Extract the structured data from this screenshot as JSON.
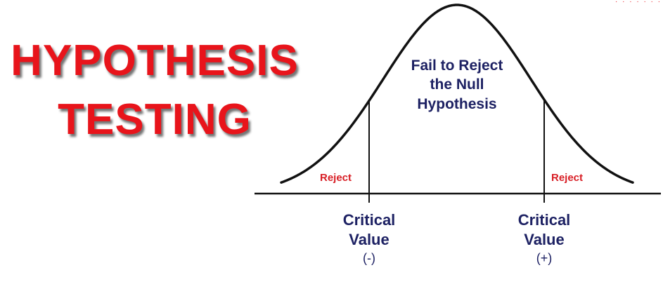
{
  "title": {
    "line1": "HYPOTHESIS",
    "line2": "TESTING"
  },
  "regions": {
    "center": "Fail to Reject the Null Hypothesis",
    "center_lines": [
      "Fail to Reject",
      "the Null",
      "Hypothesis"
    ],
    "left_tail": "Reject",
    "right_tail": "Reject"
  },
  "critical_values": [
    {
      "line1": "Critical",
      "line2": "Value",
      "sign": "(-)"
    },
    {
      "line1": "Critical",
      "line2": "Value",
      "sign": "(+)"
    }
  ],
  "colors": {
    "title": "#e8141b",
    "reject": "#d81e25",
    "labels": "#1d2163",
    "curve": "#111111"
  }
}
